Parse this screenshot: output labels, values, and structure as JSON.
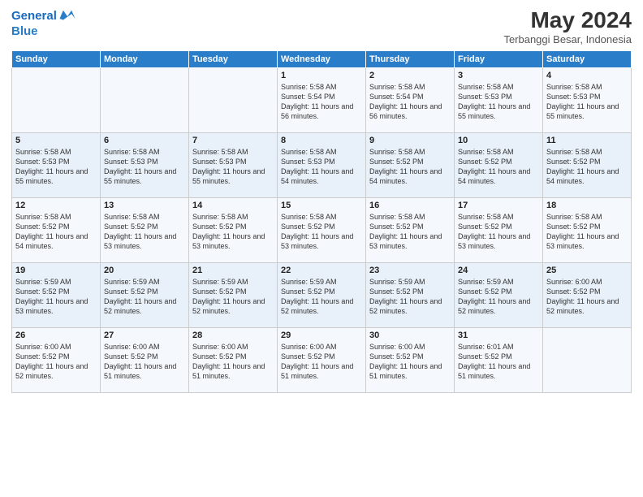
{
  "logo": {
    "line1": "General",
    "line2": "Blue"
  },
  "title": "May 2024",
  "subtitle": "Terbanggi Besar, Indonesia",
  "weekdays": [
    "Sunday",
    "Monday",
    "Tuesday",
    "Wednesday",
    "Thursday",
    "Friday",
    "Saturday"
  ],
  "weeks": [
    [
      {
        "day": "",
        "sunrise": "",
        "sunset": "",
        "daylight": ""
      },
      {
        "day": "",
        "sunrise": "",
        "sunset": "",
        "daylight": ""
      },
      {
        "day": "",
        "sunrise": "",
        "sunset": "",
        "daylight": ""
      },
      {
        "day": "1",
        "sunrise": "Sunrise: 5:58 AM",
        "sunset": "Sunset: 5:54 PM",
        "daylight": "Daylight: 11 hours and 56 minutes."
      },
      {
        "day": "2",
        "sunrise": "Sunrise: 5:58 AM",
        "sunset": "Sunset: 5:54 PM",
        "daylight": "Daylight: 11 hours and 56 minutes."
      },
      {
        "day": "3",
        "sunrise": "Sunrise: 5:58 AM",
        "sunset": "Sunset: 5:53 PM",
        "daylight": "Daylight: 11 hours and 55 minutes."
      },
      {
        "day": "4",
        "sunrise": "Sunrise: 5:58 AM",
        "sunset": "Sunset: 5:53 PM",
        "daylight": "Daylight: 11 hours and 55 minutes."
      }
    ],
    [
      {
        "day": "5",
        "sunrise": "Sunrise: 5:58 AM",
        "sunset": "Sunset: 5:53 PM",
        "daylight": "Daylight: 11 hours and 55 minutes."
      },
      {
        "day": "6",
        "sunrise": "Sunrise: 5:58 AM",
        "sunset": "Sunset: 5:53 PM",
        "daylight": "Daylight: 11 hours and 55 minutes."
      },
      {
        "day": "7",
        "sunrise": "Sunrise: 5:58 AM",
        "sunset": "Sunset: 5:53 PM",
        "daylight": "Daylight: 11 hours and 55 minutes."
      },
      {
        "day": "8",
        "sunrise": "Sunrise: 5:58 AM",
        "sunset": "Sunset: 5:53 PM",
        "daylight": "Daylight: 11 hours and 54 minutes."
      },
      {
        "day": "9",
        "sunrise": "Sunrise: 5:58 AM",
        "sunset": "Sunset: 5:52 PM",
        "daylight": "Daylight: 11 hours and 54 minutes."
      },
      {
        "day": "10",
        "sunrise": "Sunrise: 5:58 AM",
        "sunset": "Sunset: 5:52 PM",
        "daylight": "Daylight: 11 hours and 54 minutes."
      },
      {
        "day": "11",
        "sunrise": "Sunrise: 5:58 AM",
        "sunset": "Sunset: 5:52 PM",
        "daylight": "Daylight: 11 hours and 54 minutes."
      }
    ],
    [
      {
        "day": "12",
        "sunrise": "Sunrise: 5:58 AM",
        "sunset": "Sunset: 5:52 PM",
        "daylight": "Daylight: 11 hours and 54 minutes."
      },
      {
        "day": "13",
        "sunrise": "Sunrise: 5:58 AM",
        "sunset": "Sunset: 5:52 PM",
        "daylight": "Daylight: 11 hours and 53 minutes."
      },
      {
        "day": "14",
        "sunrise": "Sunrise: 5:58 AM",
        "sunset": "Sunset: 5:52 PM",
        "daylight": "Daylight: 11 hours and 53 minutes."
      },
      {
        "day": "15",
        "sunrise": "Sunrise: 5:58 AM",
        "sunset": "Sunset: 5:52 PM",
        "daylight": "Daylight: 11 hours and 53 minutes."
      },
      {
        "day": "16",
        "sunrise": "Sunrise: 5:58 AM",
        "sunset": "Sunset: 5:52 PM",
        "daylight": "Daylight: 11 hours and 53 minutes."
      },
      {
        "day": "17",
        "sunrise": "Sunrise: 5:58 AM",
        "sunset": "Sunset: 5:52 PM",
        "daylight": "Daylight: 11 hours and 53 minutes."
      },
      {
        "day": "18",
        "sunrise": "Sunrise: 5:58 AM",
        "sunset": "Sunset: 5:52 PM",
        "daylight": "Daylight: 11 hours and 53 minutes."
      }
    ],
    [
      {
        "day": "19",
        "sunrise": "Sunrise: 5:59 AM",
        "sunset": "Sunset: 5:52 PM",
        "daylight": "Daylight: 11 hours and 53 minutes."
      },
      {
        "day": "20",
        "sunrise": "Sunrise: 5:59 AM",
        "sunset": "Sunset: 5:52 PM",
        "daylight": "Daylight: 11 hours and 52 minutes."
      },
      {
        "day": "21",
        "sunrise": "Sunrise: 5:59 AM",
        "sunset": "Sunset: 5:52 PM",
        "daylight": "Daylight: 11 hours and 52 minutes."
      },
      {
        "day": "22",
        "sunrise": "Sunrise: 5:59 AM",
        "sunset": "Sunset: 5:52 PM",
        "daylight": "Daylight: 11 hours and 52 minutes."
      },
      {
        "day": "23",
        "sunrise": "Sunrise: 5:59 AM",
        "sunset": "Sunset: 5:52 PM",
        "daylight": "Daylight: 11 hours and 52 minutes."
      },
      {
        "day": "24",
        "sunrise": "Sunrise: 5:59 AM",
        "sunset": "Sunset: 5:52 PM",
        "daylight": "Daylight: 11 hours and 52 minutes."
      },
      {
        "day": "25",
        "sunrise": "Sunrise: 6:00 AM",
        "sunset": "Sunset: 5:52 PM",
        "daylight": "Daylight: 11 hours and 52 minutes."
      }
    ],
    [
      {
        "day": "26",
        "sunrise": "Sunrise: 6:00 AM",
        "sunset": "Sunset: 5:52 PM",
        "daylight": "Daylight: 11 hours and 52 minutes."
      },
      {
        "day": "27",
        "sunrise": "Sunrise: 6:00 AM",
        "sunset": "Sunset: 5:52 PM",
        "daylight": "Daylight: 11 hours and 51 minutes."
      },
      {
        "day": "28",
        "sunrise": "Sunrise: 6:00 AM",
        "sunset": "Sunset: 5:52 PM",
        "daylight": "Daylight: 11 hours and 51 minutes."
      },
      {
        "day": "29",
        "sunrise": "Sunrise: 6:00 AM",
        "sunset": "Sunset: 5:52 PM",
        "daylight": "Daylight: 11 hours and 51 minutes."
      },
      {
        "day": "30",
        "sunrise": "Sunrise: 6:00 AM",
        "sunset": "Sunset: 5:52 PM",
        "daylight": "Daylight: 11 hours and 51 minutes."
      },
      {
        "day": "31",
        "sunrise": "Sunrise: 6:01 AM",
        "sunset": "Sunset: 5:52 PM",
        "daylight": "Daylight: 11 hours and 51 minutes."
      },
      {
        "day": "",
        "sunrise": "",
        "sunset": "",
        "daylight": ""
      }
    ]
  ]
}
